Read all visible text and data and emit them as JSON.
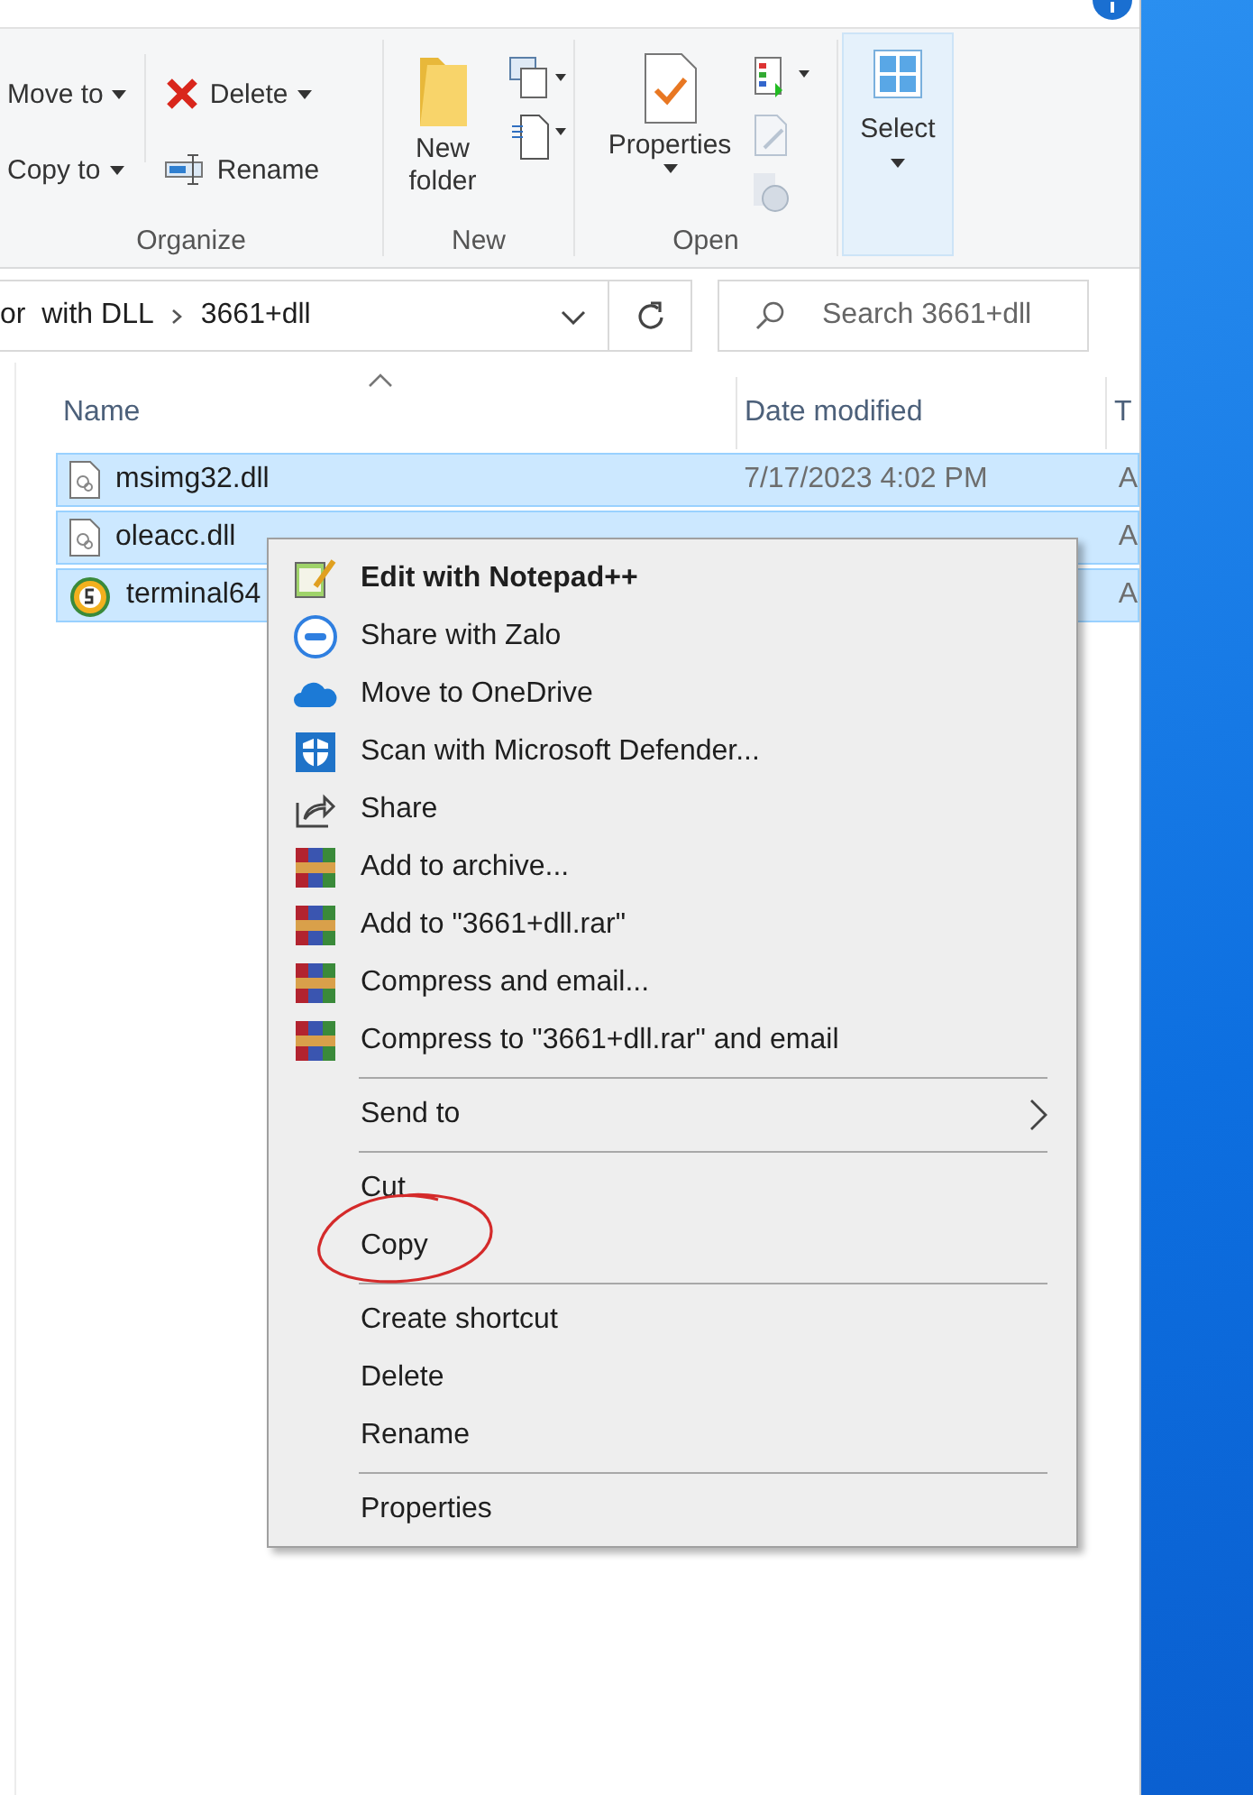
{
  "ribbon": {
    "groups": [
      {
        "label": "Organize",
        "buttons": [
          {
            "label": "Move to",
            "dropdown": true
          },
          {
            "label": "Copy to",
            "dropdown": true
          },
          {
            "label": "Delete",
            "dropdown": true
          },
          {
            "label": "Rename",
            "dropdown": false
          }
        ]
      },
      {
        "label": "New",
        "buttons": [
          {
            "label": "New folder",
            "dropdown": false
          }
        ]
      },
      {
        "label": "Open",
        "buttons": [
          {
            "label": "Properties",
            "dropdown": true
          }
        ]
      },
      {
        "buttons": [
          {
            "label": "Select",
            "dropdown": true
          }
        ]
      }
    ]
  },
  "address": {
    "crumbs": [
      "or  with DLL",
      "3661+dll"
    ],
    "search_placeholder": "Search 3661+dll"
  },
  "columns": [
    {
      "label": "Name",
      "sorted": true
    },
    {
      "label": "Date modified",
      "sorted": false
    },
    {
      "label": "T",
      "sorted": false
    }
  ],
  "files": [
    {
      "name": "msimg32.dll",
      "date": "7/17/2023 4:02 PM",
      "type": "A",
      "kind": "dll",
      "selected": true
    },
    {
      "name": "oleacc.dll",
      "type": "A",
      "kind": "dll",
      "selected": true
    },
    {
      "name": "terminal64",
      "type": "A",
      "kind": "app",
      "selected": true
    }
  ],
  "context_menu": [
    {
      "kind": "notepad",
      "label": "Edit with Notepad++",
      "bold": true
    },
    {
      "kind": "zalo",
      "label": "Share with Zalo",
      "bold": false
    },
    {
      "kind": "onedrive",
      "label": "Move to OneDrive",
      "bold": false
    },
    {
      "kind": "defender",
      "label": "Scan with Microsoft Defender...",
      "bold": false
    },
    {
      "kind": "share",
      "label": "Share",
      "bold": false
    },
    {
      "kind": "winrar",
      "label": "Add to archive...",
      "bold": false
    },
    {
      "kind": "winrar",
      "label": "Add to \"3661+dll.rar\"",
      "bold": false
    },
    {
      "kind": "winrar",
      "label": "Compress and email...",
      "bold": false
    },
    {
      "kind": "winrar",
      "label": "Compress to \"3661+dll.rar\" and email",
      "bold": false
    },
    {
      "kind": "separator"
    },
    {
      "kind": "submenu",
      "label": "Send to",
      "bold": false
    },
    {
      "kind": "separator"
    },
    {
      "kind": "plain",
      "label": "Cut",
      "bold": false
    },
    {
      "kind": "plain",
      "label": "Copy",
      "bold": false,
      "circled": true
    },
    {
      "kind": "separator"
    },
    {
      "kind": "plain",
      "label": "Create shortcut",
      "bold": false
    },
    {
      "kind": "plain",
      "label": "Delete",
      "bold": false
    },
    {
      "kind": "plain",
      "label": "Rename",
      "bold": false
    },
    {
      "kind": "separator"
    },
    {
      "kind": "plain",
      "label": "Properties",
      "bold": false
    }
  ]
}
